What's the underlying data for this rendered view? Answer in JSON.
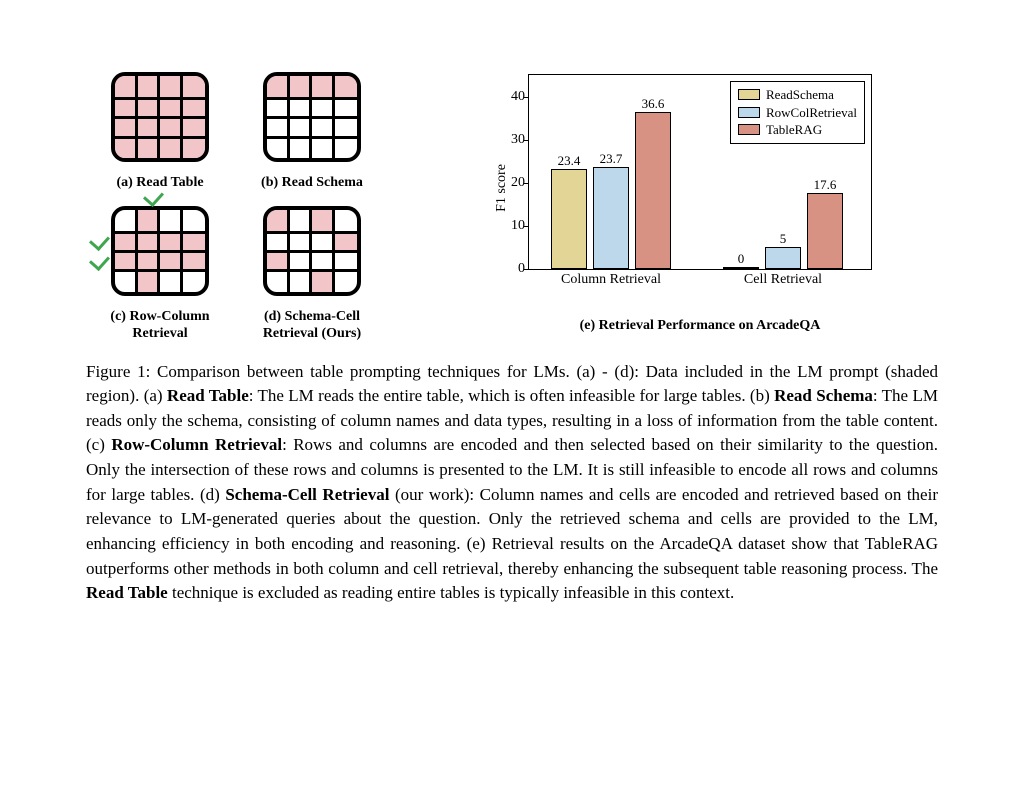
{
  "panels": {
    "a_label": "(a) Read Table",
    "b_label": "(b) Read Schema",
    "c_label_l1": "(c) Row-Column",
    "c_label_l2": "Retrieval",
    "d_label_l1": "(d) Schema-Cell",
    "d_label_l2": "Retrieval (Ours)"
  },
  "chart_data": {
    "type": "bar",
    "ylabel": "F1 score",
    "ylim": [
      0,
      45
    ],
    "yticks": [
      0,
      10,
      20,
      30,
      40
    ],
    "categories": [
      "Column Retrieval",
      "Cell Retrieval"
    ],
    "series": [
      {
        "name": "ReadSchema",
        "values": [
          23.4,
          0
        ],
        "color": "#e3d595"
      },
      {
        "name": "RowColRetrieval",
        "values": [
          23.7,
          5
        ],
        "color": "#bcd8ea"
      },
      {
        "name": "TableRAG",
        "values": [
          36.6,
          17.6
        ],
        "color": "#d89283"
      }
    ],
    "bar_labels": {
      "g0": [
        "23.4",
        "23.7",
        "36.6"
      ],
      "g1": [
        "0",
        "5",
        "17.6"
      ]
    },
    "legend_position": "top-right"
  },
  "chart_caption": "(e) Retrieval Performance on ArcadeQA",
  "caption": {
    "lead": "Figure 1: Comparison between table prompting techniques for LMs. (a) - (d): Data included in the LM prompt (shaded region). (a) ",
    "b1": "Read Table",
    "t1": ": The LM reads the entire table, which is often infeasible for large tables. (b) ",
    "b2": "Read Schema",
    "t2": ": The LM reads only the schema, consisting of column names and data types, resulting in a loss of information from the table content. (c) ",
    "b3": "Row-Column Retrieval",
    "t3": ": Rows and columns are encoded and then selected based on their similarity to the question. Only the intersection of these rows and columns is presented to the LM. It is still infeasible to encode all rows and columns for large tables. (d) ",
    "b4": "Schema-Cell Retrieval",
    "t4": " (our work): Column names and cells are encoded and retrieved based on their relevance to LM-generated queries about the question. Only the retrieved schema and cells are provided to the LM, enhancing efficiency in both encoding and reasoning. (e) Retrieval results on the ArcadeQA dataset show that TableRAG outperforms other methods in both column and cell retrieval, thereby enhancing the subsequent table reasoning process. The ",
    "b5": "Read Table",
    "t5": " technique is excluded as reading entire tables is typically infeasible in this context."
  }
}
